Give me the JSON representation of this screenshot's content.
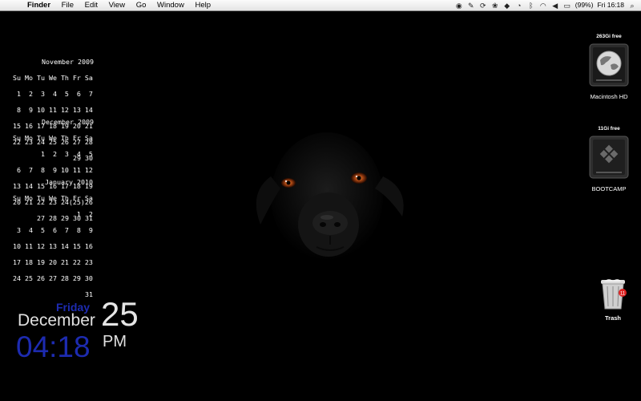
{
  "menubar": {
    "app": "Finder",
    "menus": [
      "File",
      "Edit",
      "View",
      "Go",
      "Window",
      "Help"
    ],
    "battery": "(99%)",
    "clock": "Fri 16:18"
  },
  "calendar": [
    {
      "title": "November 2009",
      "header": "Su Mo Tu We Th Fr Sa",
      "weeks": [
        " 1  2  3  4  5  6  7",
        " 8  9 10 11 12 13 14",
        "15 16 17 18 19 20 21",
        "22 23 24 25 26 27 28",
        "29 30"
      ]
    },
    {
      "title": "December 2009",
      "header": "Su Mo Tu We Th Fr Sa",
      "weeks": [
        "       1  2  3  4  5",
        " 6  7  8  9 10 11 12",
        "13 14 15 16 17 18 19",
        "20 21 22 23 24(25)26",
        "27 28 29 30 31"
      ]
    },
    {
      "title": "January 2010",
      "header": "Su Mo Tu We Th Fr Sa",
      "weeks": [
        "                1  2",
        " 3  4  5  6  7  8  9",
        "10 11 12 13 14 15 16",
        "17 18 19 20 21 22 23",
        "24 25 26 27 28 29 30",
        "31"
      ]
    }
  ],
  "clock": {
    "day": "Friday",
    "month": "December",
    "date": "25",
    "time": "04:18",
    "ampm": "PM"
  },
  "desktop_icons": {
    "macintosh_hd": {
      "free": "263Gi free",
      "label": "Macintosh HD"
    },
    "bootcamp": {
      "free": "11Gi free",
      "label": "BOOTCAMP"
    },
    "trash": {
      "label": "Trash",
      "badge": "11"
    }
  }
}
